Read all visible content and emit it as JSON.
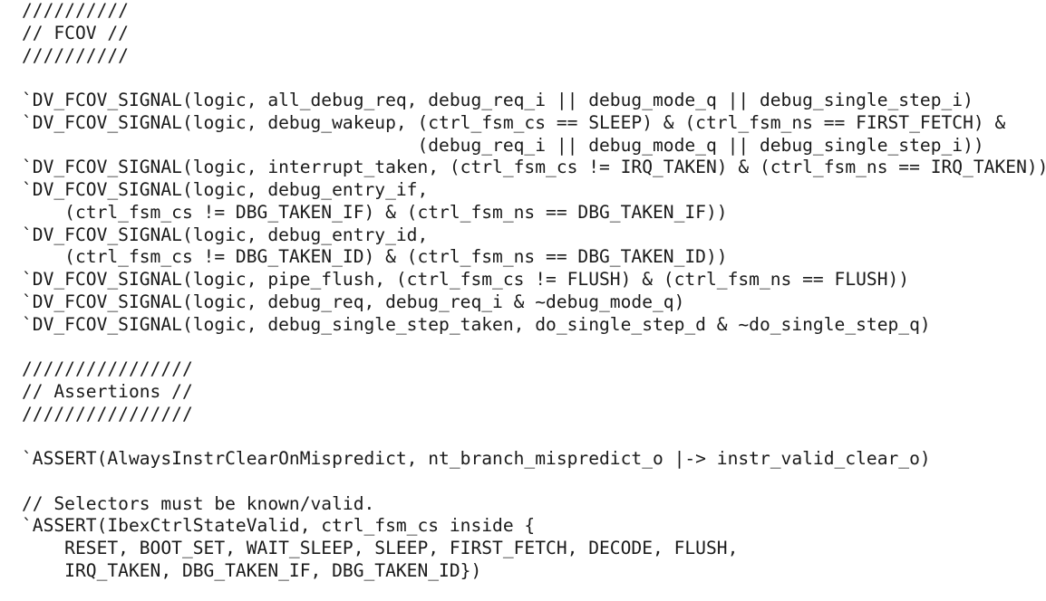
{
  "code": {
    "lines": [
      "//////////",
      "// FCOV //",
      "//////////",
      "",
      "`DV_FCOV_SIGNAL(logic, all_debug_req, debug_req_i || debug_mode_q || debug_single_step_i)",
      "`DV_FCOV_SIGNAL(logic, debug_wakeup, (ctrl_fsm_cs == SLEEP) & (ctrl_fsm_ns == FIRST_FETCH) &",
      "                                     (debug_req_i || debug_mode_q || debug_single_step_i))",
      "`DV_FCOV_SIGNAL(logic, interrupt_taken, (ctrl_fsm_cs != IRQ_TAKEN) & (ctrl_fsm_ns == IRQ_TAKEN))",
      "`DV_FCOV_SIGNAL(logic, debug_entry_if,",
      "    (ctrl_fsm_cs != DBG_TAKEN_IF) & (ctrl_fsm_ns == DBG_TAKEN_IF))",
      "`DV_FCOV_SIGNAL(logic, debug_entry_id,",
      "    (ctrl_fsm_cs != DBG_TAKEN_ID) & (ctrl_fsm_ns == DBG_TAKEN_ID))",
      "`DV_FCOV_SIGNAL(logic, pipe_flush, (ctrl_fsm_cs != FLUSH) & (ctrl_fsm_ns == FLUSH))",
      "`DV_FCOV_SIGNAL(logic, debug_req, debug_req_i & ~debug_mode_q)",
      "`DV_FCOV_SIGNAL(logic, debug_single_step_taken, do_single_step_d & ~do_single_step_q)",
      "",
      "////////////////",
      "// Assertions //",
      "////////////////",
      "",
      "`ASSERT(AlwaysInstrClearOnMispredict, nt_branch_mispredict_o |-> instr_valid_clear_o)",
      "",
      "// Selectors must be known/valid.",
      "`ASSERT(IbexCtrlStateValid, ctrl_fsm_cs inside {",
      "    RESET, BOOT_SET, WAIT_SLEEP, SLEEP, FIRST_FETCH, DECODE, FLUSH,",
      "    IRQ_TAKEN, DBG_TAKEN_IF, DBG_TAKEN_ID})"
    ]
  }
}
